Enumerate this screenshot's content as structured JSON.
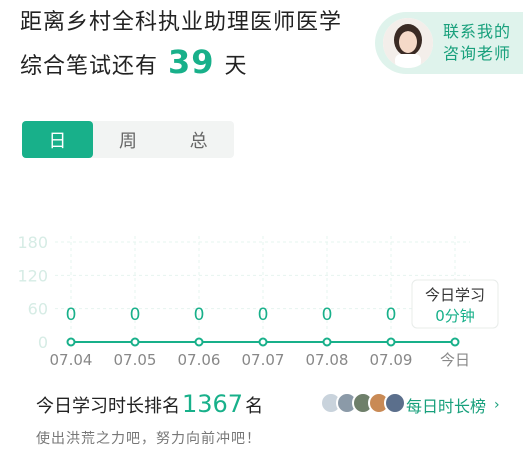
{
  "header": {
    "line1": "距离乡村全科执业助理医师医学",
    "line2_prefix": "综合笔试还有",
    "days": "39",
    "line2_suffix": "天"
  },
  "teacher": {
    "line1": "联系我的",
    "line2": "咨询老师"
  },
  "tabs": [
    {
      "label": "日",
      "active": true
    },
    {
      "label": "周",
      "active": false
    },
    {
      "label": "总",
      "active": false
    }
  ],
  "chart_data": {
    "type": "line",
    "categories": [
      "07.04",
      "07.05",
      "07.06",
      "07.07",
      "07.08",
      "07.09",
      "今日"
    ],
    "series": [
      {
        "values": [
          0,
          0,
          0,
          0,
          0,
          0,
          0
        ]
      }
    ],
    "data_labels": [
      "0",
      "0",
      "0",
      "0",
      "0",
      "0"
    ],
    "yticks": [
      "0",
      "60",
      "120",
      "180"
    ],
    "ylim": [
      0,
      180
    ],
    "grid": true,
    "tooltip": {
      "title": "今日学习",
      "value": "0分钟"
    },
    "color": "#18b08a"
  },
  "rank": {
    "prefix": "今日学习时长排名",
    "number": "1367",
    "suffix": "名",
    "motto": "使出洪荒之力吧，努力向前冲吧！",
    "link": "每日时长榜"
  },
  "colors": {
    "accent": "#18b08a",
    "accent_light": "#dff3ec"
  }
}
